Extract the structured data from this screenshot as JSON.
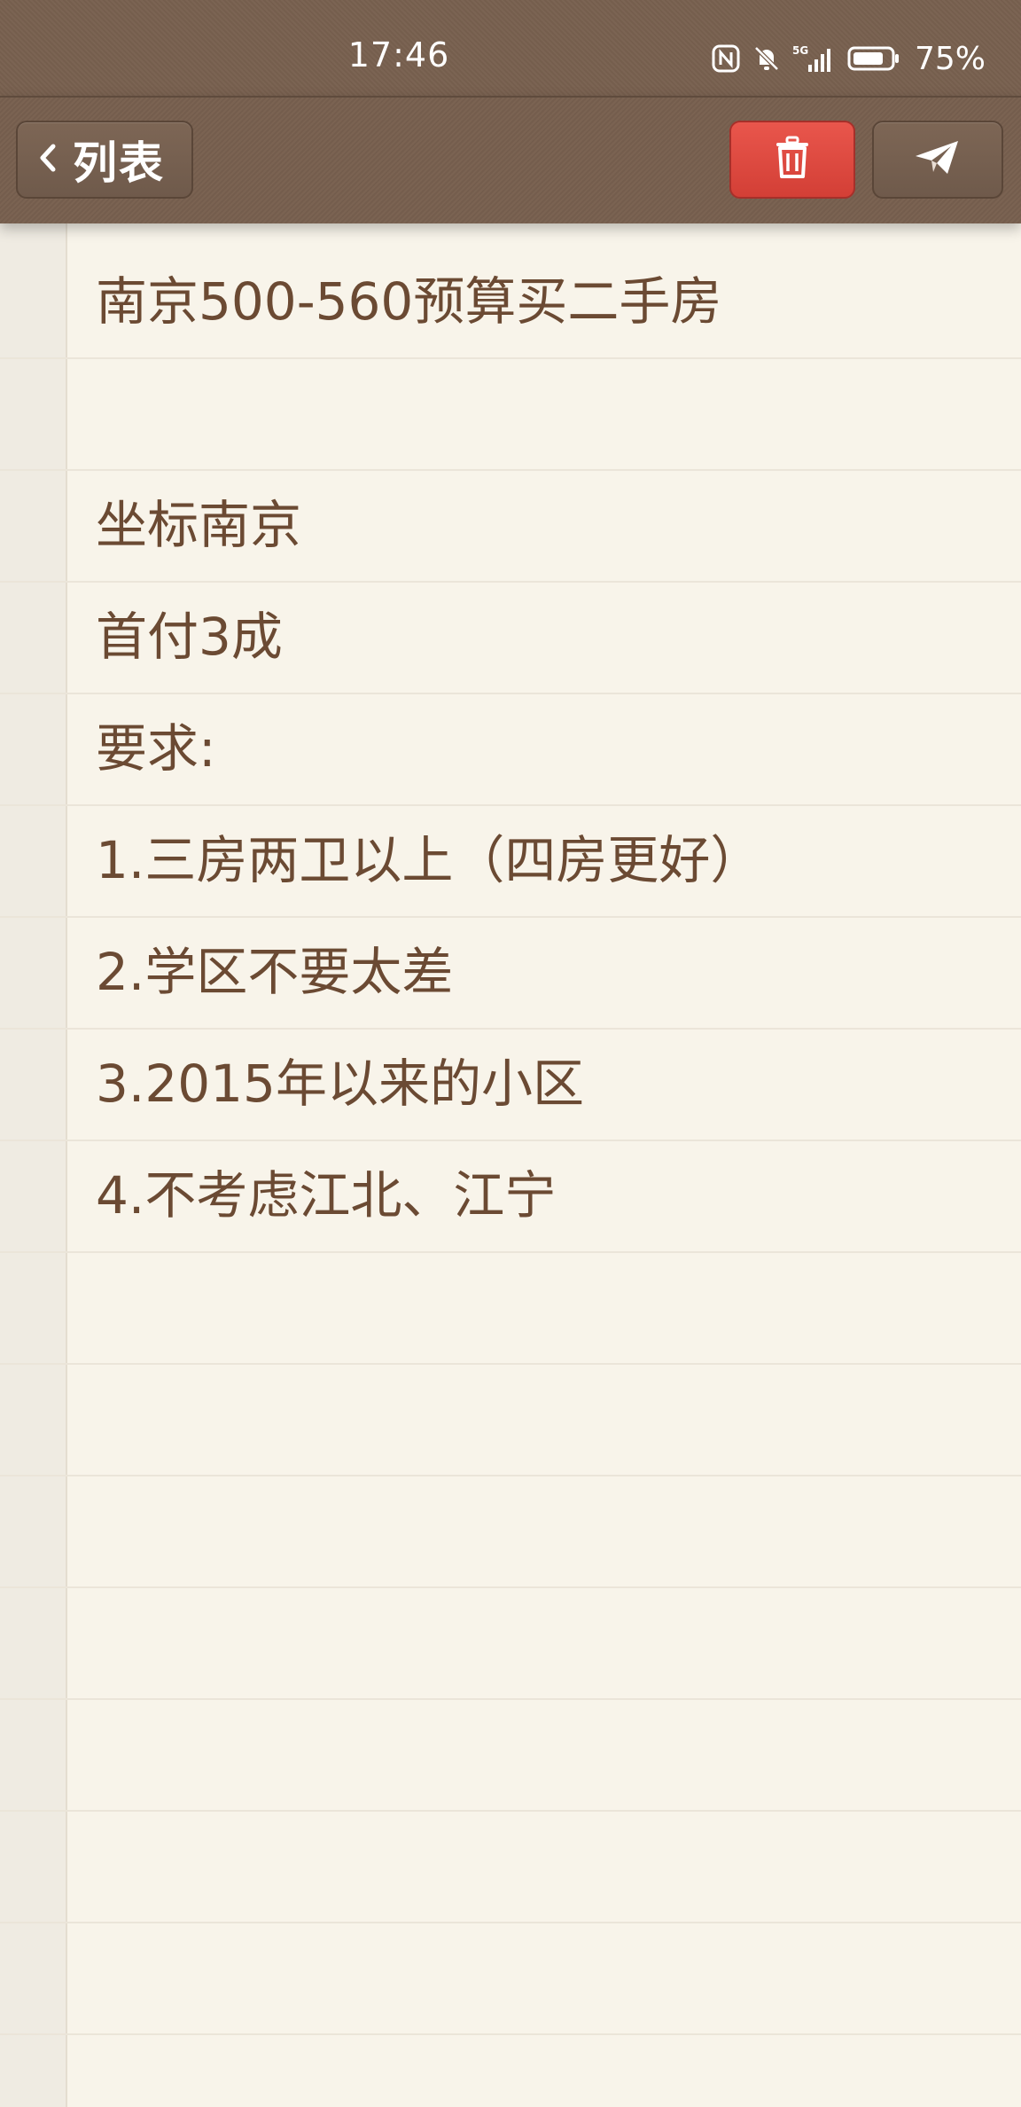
{
  "status_bar": {
    "time": "17:46",
    "network": "5G",
    "battery_percent": "75%",
    "icons": [
      "nfc-icon",
      "mute-bell-icon",
      "signal-5g-icon",
      "battery-icon"
    ]
  },
  "toolbar": {
    "back_label": "列表",
    "back_icon": "chevron-left-icon",
    "delete_icon": "trash-icon",
    "send_icon": "paper-plane-icon",
    "colors": {
      "delete": "#dd4a40",
      "bar": "#78604f"
    }
  },
  "note": {
    "lines": [
      "南京500-560预算买二手房",
      "",
      "坐标南京",
      "首付3成",
      "要求:",
      "1.三房两卫以上（四房更好）",
      "2.学区不要太差",
      "3.2015年以来的小区",
      "4.不考虑江北、江宁"
    ]
  }
}
